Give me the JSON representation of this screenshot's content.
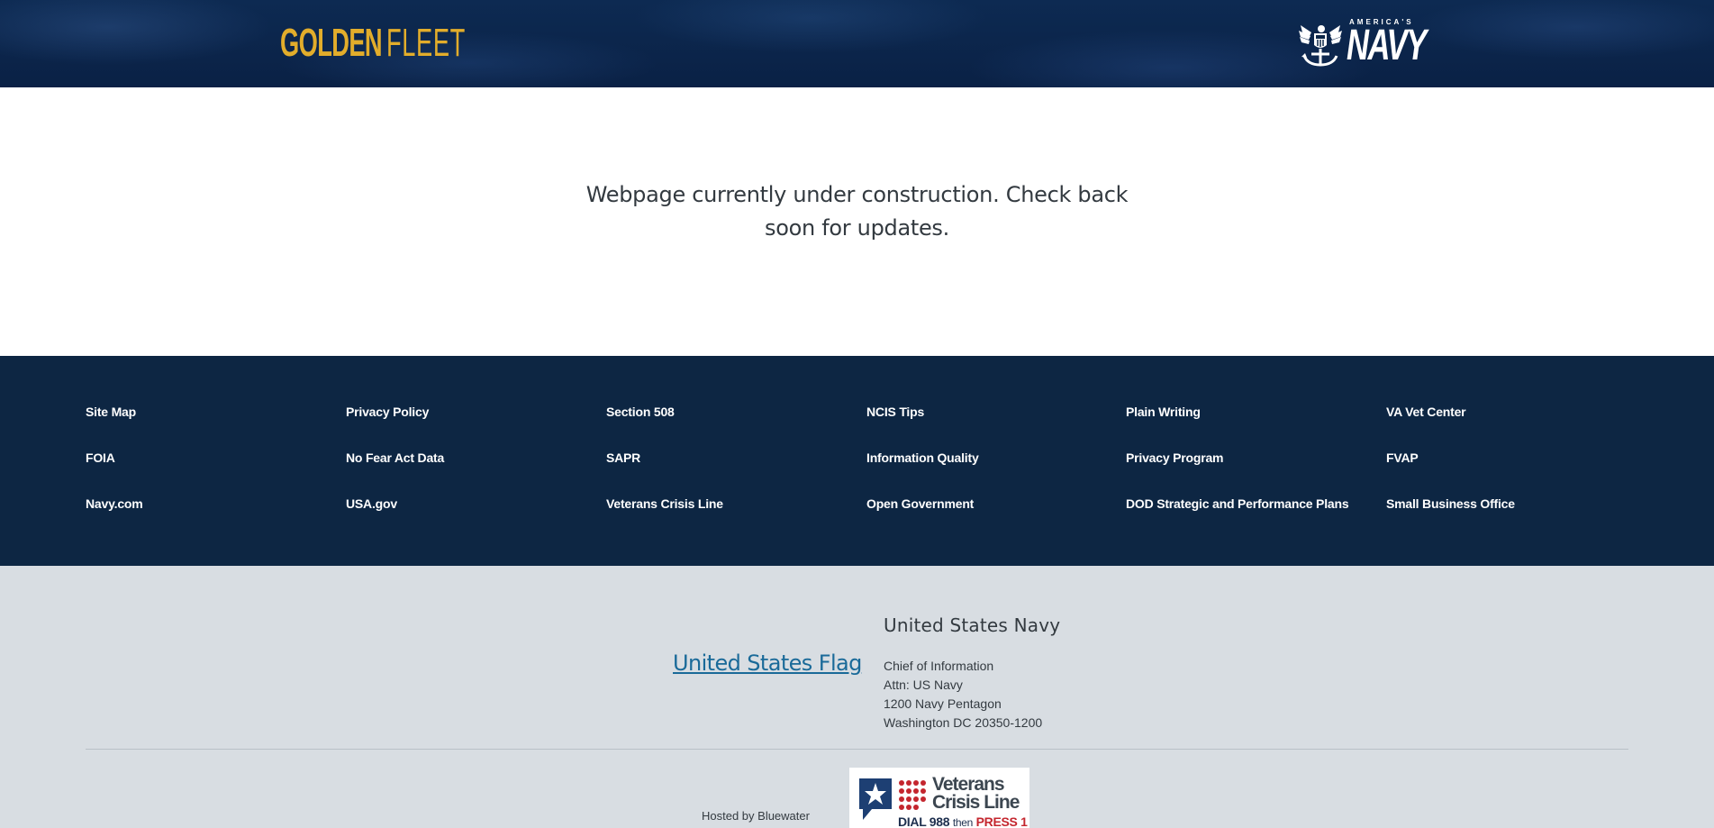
{
  "header": {
    "brand_primary": "GOLDEN",
    "brand_secondary": "FLEET",
    "navy_logo_small": "AMERICA'S",
    "navy_logo_main": "NAVY",
    "brand_color": "#e2ad2b",
    "background_color": "#0b2547"
  },
  "main": {
    "message": "Webpage currently under construction. Check back soon for updates."
  },
  "footer_links": {
    "columns": [
      [
        "Site Map",
        "FOIA",
        "Navy.com"
      ],
      [
        "Privacy Policy",
        "No Fear Act Data",
        "USA.gov"
      ],
      [
        "Section 508",
        "SAPR",
        "Veterans Crisis Line"
      ],
      [
        "NCIS Tips",
        "Information Quality",
        "Open Government"
      ],
      [
        "Plain Writing",
        "Privacy Program",
        "DOD Strategic and Performance Plans"
      ],
      [
        "VA Vet Center",
        "FVAP",
        "Small Business Office"
      ]
    ],
    "background_color": "#0d2643"
  },
  "footer_lower": {
    "flag_link": "United States Flag",
    "org_name": "United States Navy",
    "address": [
      "Chief of Information",
      "Attn: US Navy",
      "1200 Navy Pentagon",
      "Washington DC 20350-1200"
    ],
    "hosted_by": "Hosted by Bluewater",
    "vcl_badge": {
      "title_line1": "Veterans",
      "title_line2": "Crisis Line",
      "dial": "DIAL 988",
      "then": "then",
      "press": "PRESS",
      "press_number": "1"
    },
    "background_color": "#d8dde2",
    "link_color": "#1a6a99"
  }
}
